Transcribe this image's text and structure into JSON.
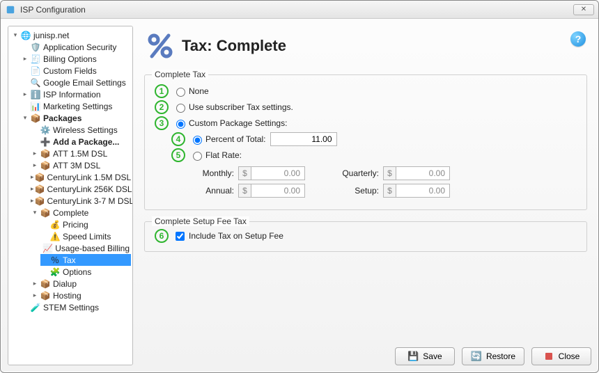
{
  "window": {
    "title": "ISP Configuration"
  },
  "tree": {
    "root": "junisp.net",
    "items": [
      "Application Security",
      "Billing Options",
      "Custom Fields",
      "Google Email Settings",
      "ISP Information",
      "Marketing Settings",
      "STEM Settings"
    ],
    "packages": {
      "label": "Packages",
      "items": [
        "Wireless Settings",
        "Add a Package...",
        "ATT 1.5M DSL",
        "ATT 3M DSL",
        "CenturyLink 1.5M DSL",
        "CenturyLink 256K DSL",
        "CenturyLink 3-7 M DSL",
        "Dialup",
        "Hosting"
      ],
      "complete": {
        "label": "Complete",
        "items": [
          "Pricing",
          "Speed Limits",
          "Usage-based Billing",
          "Tax",
          "Options"
        ]
      }
    }
  },
  "page": {
    "title": "Tax: Complete"
  },
  "callouts": [
    "1",
    "2",
    "3",
    "4",
    "5",
    "6"
  ],
  "form": {
    "currency": "$",
    "tax": {
      "legend": "Complete Tax",
      "options": {
        "none": "None",
        "subscriber": "Use subscriber Tax settings.",
        "custom": "Custom Package Settings:"
      },
      "custom": {
        "percent_label": "Percent of Total:",
        "percent_value": "11.00",
        "flat_label": "Flat Rate:",
        "rates": {
          "monthly": {
            "label": "Monthly:",
            "value": "0.00"
          },
          "quarterly": {
            "label": "Quarterly:",
            "value": "0.00"
          },
          "annual": {
            "label": "Annual:",
            "value": "0.00"
          },
          "setup": {
            "label": "Setup:",
            "value": "0.00"
          }
        }
      }
    },
    "setupfee": {
      "legend": "Complete Setup Fee Tax",
      "include_label": "Include Tax on Setup Fee"
    }
  },
  "buttons": {
    "save": "Save",
    "restore": "Restore",
    "close": "Close"
  }
}
